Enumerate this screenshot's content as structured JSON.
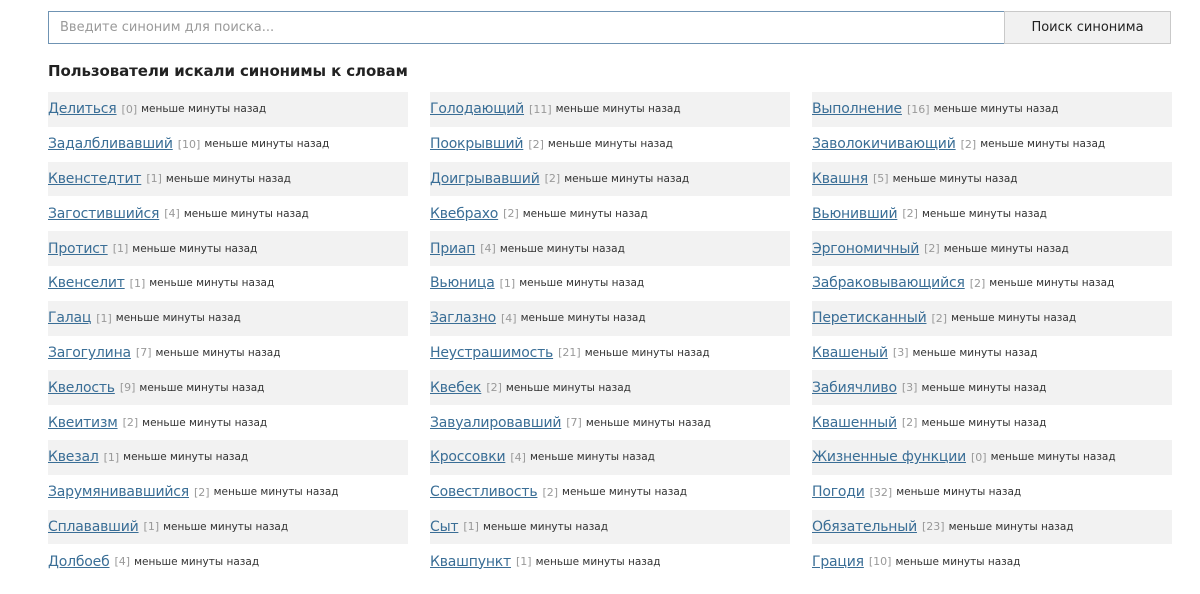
{
  "search": {
    "placeholder": "Введите синоним для поиска...",
    "button_label": "Поиск синонима"
  },
  "section_title": "Пользователи искали синонимы к словам",
  "columns": [
    [
      {
        "word": "Делиться",
        "count": "[0]",
        "time": "меньше минуты назад"
      },
      {
        "word": "Задалбливавший",
        "count": "[10]",
        "time": "меньше минуты назад"
      },
      {
        "word": "Квенстедтит",
        "count": "[1]",
        "time": "меньше минуты назад"
      },
      {
        "word": "Загостившийся",
        "count": "[4]",
        "time": "меньше минуты назад"
      },
      {
        "word": "Протист",
        "count": "[1]",
        "time": "меньше минуты назад"
      },
      {
        "word": "Квенселит",
        "count": "[1]",
        "time": "меньше минуты назад"
      },
      {
        "word": "Галац",
        "count": "[1]",
        "time": "меньше минуты назад"
      },
      {
        "word": "Загогулина",
        "count": "[7]",
        "time": "меньше минуты назад"
      },
      {
        "word": "Квелость",
        "count": "[9]",
        "time": "меньше минуты назад"
      },
      {
        "word": "Квеитизм",
        "count": "[2]",
        "time": "меньше минуты назад"
      },
      {
        "word": "Квезал",
        "count": "[1]",
        "time": "меньше минуты назад"
      },
      {
        "word": "Зарумянивавшийся",
        "count": "[2]",
        "time": "меньше минуты назад"
      },
      {
        "word": "Сплававший",
        "count": "[1]",
        "time": "меньше минуты назад"
      },
      {
        "word": "Долбоеб",
        "count": "[4]",
        "time": "меньше минуты назад"
      }
    ],
    [
      {
        "word": "Голодающий",
        "count": "[11]",
        "time": "меньше минуты назад"
      },
      {
        "word": "Поокрывший",
        "count": "[2]",
        "time": "меньше минуты назад"
      },
      {
        "word": "Доигрывавший",
        "count": "[2]",
        "time": "меньше минуты назад"
      },
      {
        "word": "Квебрахо",
        "count": "[2]",
        "time": "меньше минуты назад"
      },
      {
        "word": "Приап",
        "count": "[4]",
        "time": "меньше минуты назад"
      },
      {
        "word": "Вьюница",
        "count": "[1]",
        "time": "меньше минуты назад"
      },
      {
        "word": "Заглазно",
        "count": "[4]",
        "time": "меньше минуты назад"
      },
      {
        "word": "Неустрашимость",
        "count": "[21]",
        "time": "меньше минуты назад"
      },
      {
        "word": "Квебек",
        "count": "[2]",
        "time": "меньше минуты назад"
      },
      {
        "word": "Завуалировавший",
        "count": "[7]",
        "time": "меньше минуты назад"
      },
      {
        "word": "Кроссовки",
        "count": "[4]",
        "time": "меньше минуты назад"
      },
      {
        "word": "Совестливость",
        "count": "[2]",
        "time": "меньше минуты назад"
      },
      {
        "word": "Сыт",
        "count": "[1]",
        "time": "меньше минуты назад"
      },
      {
        "word": "Квашпункт",
        "count": "[1]",
        "time": "меньше минуты назад"
      }
    ],
    [
      {
        "word": "Выполнение",
        "count": "[16]",
        "time": "меньше минуты назад"
      },
      {
        "word": "Заволокичивающий",
        "count": "[2]",
        "time": "меньше минуты назад"
      },
      {
        "word": "Квашня",
        "count": "[5]",
        "time": "меньше минуты назад"
      },
      {
        "word": "Вьюнивший",
        "count": "[2]",
        "time": "меньше минуты назад"
      },
      {
        "word": "Эргономичный",
        "count": "[2]",
        "time": "меньше минуты назад"
      },
      {
        "word": "Забраковывающийся",
        "count": "[2]",
        "time": "меньше минуты назад"
      },
      {
        "word": "Перетисканный",
        "count": "[2]",
        "time": "меньше минуты назад"
      },
      {
        "word": "Квашеный",
        "count": "[3]",
        "time": "меньше минуты назад"
      },
      {
        "word": "Забиячливо",
        "count": "[3]",
        "time": "меньше минуты назад"
      },
      {
        "word": "Квашенный",
        "count": "[2]",
        "time": "меньше минуты назад"
      },
      {
        "word": "Жизненные функции",
        "count": "[0]",
        "time": "меньше минуты назад"
      },
      {
        "word": "Погоди",
        "count": "[32]",
        "time": "меньше минуты назад"
      },
      {
        "word": "Обязательный",
        "count": "[23]",
        "time": "меньше минуты назад"
      },
      {
        "word": "Грация",
        "count": "[10]",
        "time": "меньше минуты назад"
      }
    ]
  ],
  "colors": {
    "link": "#3a6e96",
    "row_shade": "#f2f2f2",
    "input_border": "#6f93b3"
  }
}
